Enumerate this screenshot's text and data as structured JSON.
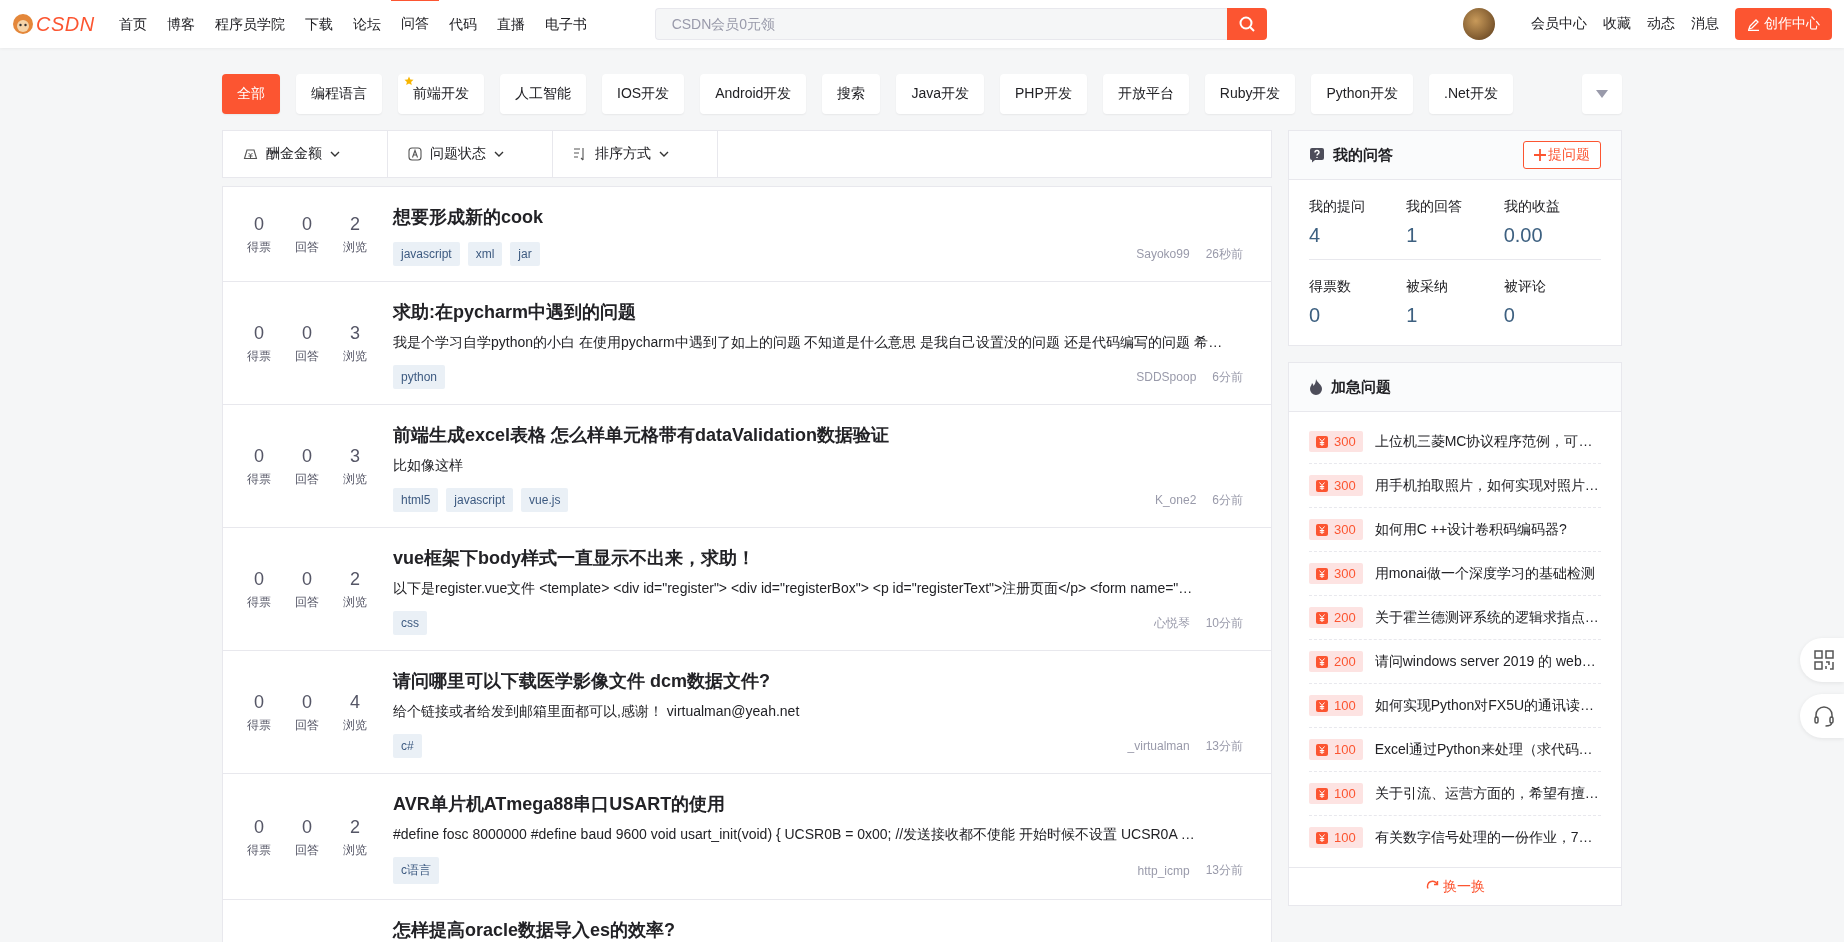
{
  "nav": {
    "logo": "CSDN",
    "items": [
      {
        "label": "首页",
        "selected": false
      },
      {
        "label": "博客",
        "selected": false
      },
      {
        "label": "程序员学院",
        "selected": false
      },
      {
        "label": "下载",
        "selected": false
      },
      {
        "label": "论坛",
        "selected": false
      },
      {
        "label": "问答",
        "selected": true
      },
      {
        "label": "代码",
        "selected": false
      },
      {
        "label": "直播",
        "selected": false
      },
      {
        "label": "电子书",
        "selected": false
      }
    ],
    "search": {
      "placeholder": "CSDN会员0元领"
    },
    "links": [
      "会员中心",
      "收藏",
      "动态",
      "消息"
    ],
    "create_button": "创作中心"
  },
  "categories": [
    {
      "label": "全部",
      "selected": true,
      "starred": false
    },
    {
      "label": "编程语言",
      "selected": false,
      "starred": false
    },
    {
      "label": "前端开发",
      "selected": false,
      "starred": true
    },
    {
      "label": "人工智能",
      "selected": false,
      "starred": false
    },
    {
      "label": "IOS开发",
      "selected": false,
      "starred": false
    },
    {
      "label": "Android开发",
      "selected": false,
      "starred": false
    },
    {
      "label": "搜索",
      "selected": false,
      "starred": false
    },
    {
      "label": "Java开发",
      "selected": false,
      "starred": false
    },
    {
      "label": "PHP开发",
      "selected": false,
      "starred": false
    },
    {
      "label": "开放平台",
      "selected": false,
      "starred": false
    },
    {
      "label": "Ruby开发",
      "selected": false,
      "starred": false
    },
    {
      "label": "Python开发",
      "selected": false,
      "starred": false
    },
    {
      "label": ".Net开发",
      "selected": false,
      "starred": false
    }
  ],
  "filters": [
    {
      "kind": "reward",
      "label": "酬金金额"
    },
    {
      "kind": "status",
      "label": "问题状态"
    },
    {
      "kind": "sort",
      "label": "排序方式"
    }
  ],
  "questions": [
    {
      "stats": [
        {
          "value": "0",
          "label": "得票"
        },
        {
          "value": "0",
          "label": "回答"
        },
        {
          "value": "2",
          "label": "浏览"
        }
      ],
      "title": "想要形成新的cook",
      "tags": [
        "javascript",
        "xml",
        "jar"
      ],
      "author": "Sayoko99",
      "time": "26秒前"
    },
    {
      "stats": [
        {
          "value": "0",
          "label": "得票"
        },
        {
          "value": "0",
          "label": "回答"
        },
        {
          "value": "3",
          "label": "浏览"
        }
      ],
      "title": "求助:在pycharm中遇到的问题",
      "excerpt": "我是个学习自学python的小白 在使用pycharm中遇到了如上的问题 不知道是什么意思 是我自己设置没的问题 还是代码编写的问题 希…",
      "tags": [
        "python"
      ],
      "author": "SDDSpoop",
      "time": "6分前"
    },
    {
      "stats": [
        {
          "value": "0",
          "label": "得票"
        },
        {
          "value": "0",
          "label": "回答"
        },
        {
          "value": "3",
          "label": "浏览"
        }
      ],
      "title": "前端生成excel表格 怎么样单元格带有dataValidation数据验证",
      "excerpt": "比如像这样",
      "tags": [
        "html5",
        "javascript",
        "vue.js"
      ],
      "author": "K_one2",
      "time": "6分前"
    },
    {
      "stats": [
        {
          "value": "0",
          "label": "得票"
        },
        {
          "value": "0",
          "label": "回答"
        },
        {
          "value": "2",
          "label": "浏览"
        }
      ],
      "title": "vue框架下body样式一直显示不出来，求助！",
      "excerpt": "以下是register.vue文件 <template> <div id=\"register\"> <div id=\"registerBox\"> <p id=\"registerText\">注册页面</p> <form name=\"…",
      "tags": [
        "css"
      ],
      "author": "心悦琴",
      "time": "10分前"
    },
    {
      "stats": [
        {
          "value": "0",
          "label": "得票"
        },
        {
          "value": "0",
          "label": "回答"
        },
        {
          "value": "4",
          "label": "浏览"
        }
      ],
      "title": "请问哪里可以下载医学影像文件 dcm数据文件?",
      "excerpt": "给个链接或者给发到邮箱里面都可以,感谢！ virtualman@yeah.net",
      "tags": [
        "c#"
      ],
      "author": "_virtualman",
      "time": "13分前"
    },
    {
      "stats": [
        {
          "value": "0",
          "label": "得票"
        },
        {
          "value": "0",
          "label": "回答"
        },
        {
          "value": "2",
          "label": "浏览"
        }
      ],
      "title": "AVR单片机ATmega88串口USART的使用",
      "excerpt": "#define fosc 8000000 #define baud 9600 void usart_init(void) { UCSR0B = 0x00; //发送接收都不使能 开始时候不设置 UCSR0A …",
      "tags": [
        "c语言"
      ],
      "author": "http_icmp",
      "time": "13分前"
    },
    {
      "title": "怎样提高oracle数据导入es的效率?"
    }
  ],
  "my_qa": {
    "title": "我的问答",
    "ask_button": "提问题",
    "stats": [
      {
        "label": "我的提问",
        "value": "4"
      },
      {
        "label": "我的回答",
        "value": "1"
      },
      {
        "label": "我的收益",
        "value": "0.00"
      },
      {
        "label": "得票数",
        "value": "0"
      },
      {
        "label": "被采纳",
        "value": "1"
      },
      {
        "label": "被评论",
        "value": "0"
      }
    ]
  },
  "urgent": {
    "title": "加急问题",
    "items": [
      {
        "reward": "300",
        "title": "上位机三菱MC协议程序范例，可…"
      },
      {
        "reward": "300",
        "title": "用手机拍取照片，如何实现对照片…"
      },
      {
        "reward": "300",
        "title": "如何用C ++设计卷积码编码器?"
      },
      {
        "reward": "300",
        "title": "用monai做一个深度学习的基础检测"
      },
      {
        "reward": "200",
        "title": "关于霍兰德测评系统的逻辑求指点…"
      },
      {
        "reward": "200",
        "title": "请问windows server 2019 的 web…"
      },
      {
        "reward": "100",
        "title": "如何实现Python对FX5U的通讯读…"
      },
      {
        "reward": "100",
        "title": "Excel通过Python来处理（求代码…"
      },
      {
        "reward": "100",
        "title": "关于引流、运营方面的，希望有擅…"
      },
      {
        "reward": "100",
        "title": "有关数字信号处理的一份作业，7…"
      }
    ],
    "refresh": "换一换"
  }
}
